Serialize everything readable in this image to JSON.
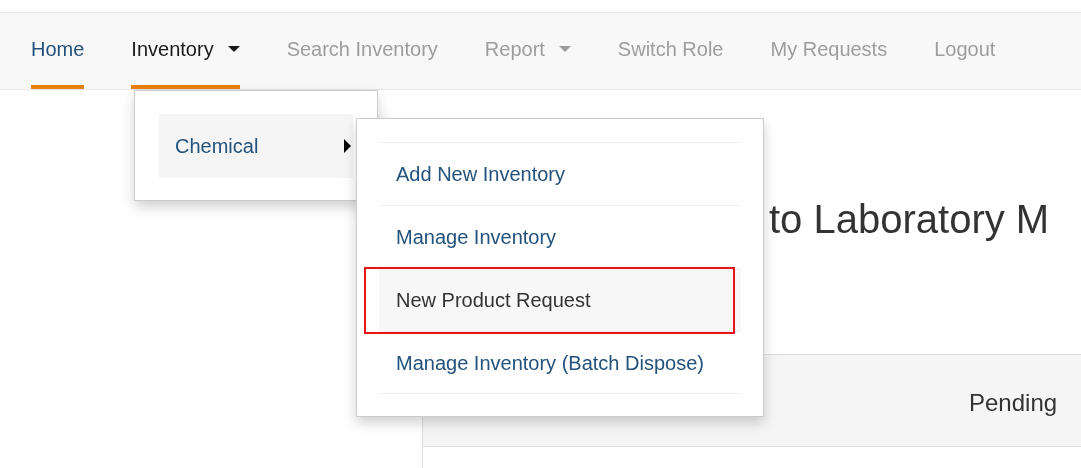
{
  "navbar": {
    "items": [
      {
        "label": "Home",
        "selected": true,
        "open": false,
        "dropdown": false
      },
      {
        "label": "Inventory",
        "selected": true,
        "open": true,
        "dropdown": true
      },
      {
        "label": "Search Inventory",
        "selected": false,
        "open": false,
        "dropdown": false
      },
      {
        "label": "Report",
        "selected": false,
        "open": false,
        "dropdown": true
      },
      {
        "label": "Switch Role",
        "selected": false,
        "open": false,
        "dropdown": false
      },
      {
        "label": "My Requests",
        "selected": false,
        "open": false,
        "dropdown": false
      },
      {
        "label": "Logout",
        "selected": false,
        "open": false,
        "dropdown": false
      }
    ]
  },
  "dropdown_menu": {
    "items": [
      {
        "label": "Chemical",
        "selected": true,
        "submenu": true
      }
    ]
  },
  "submenu": {
    "items": [
      {
        "label": "Add New Inventory",
        "selected": false,
        "highlighted": false
      },
      {
        "label": "Manage Inventory",
        "selected": false,
        "highlighted": false
      },
      {
        "label": "New Product Request",
        "selected": true,
        "highlighted": true
      },
      {
        "label": "Manage Inventory (Batch Dispose)",
        "selected": false,
        "highlighted": false
      }
    ]
  },
  "main": {
    "heading": "to Laboratory M",
    "panel": {
      "header": "Pending"
    }
  }
}
